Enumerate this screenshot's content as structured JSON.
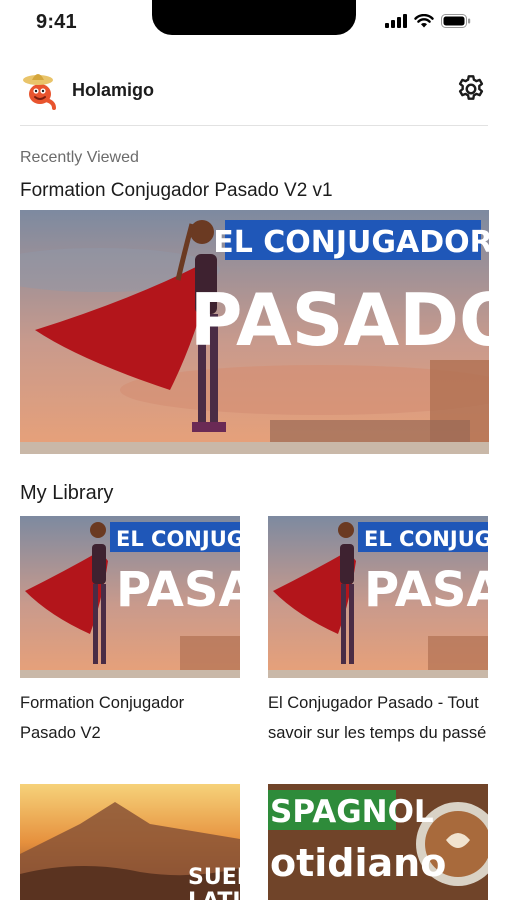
{
  "status_bar": {
    "time": "9:41"
  },
  "header": {
    "app_name": "Holamigo"
  },
  "recently_viewed": {
    "label": "Recently Viewed",
    "title": "Formation Conjugador Pasado V2 v1",
    "thumbnail": {
      "banner_line1": "EL CONJUGADOR",
      "banner_line2": "PASADO"
    }
  },
  "library": {
    "heading": "My Library",
    "items": [
      {
        "title": "Formation Conjugador Pasado V2",
        "banner_line1": "EL CONJUGAD",
        "banner_line2": "PASAD"
      },
      {
        "title": "El Conjugador Pasado - Tout savoir sur les temps du passé",
        "banner_line1": "EL CONJUGAD",
        "banner_line2": "PASAD"
      },
      {
        "banner_line1": "SUEN",
        "banner_line2": "LATIN"
      },
      {
        "banner_line1": "SPAGNOL",
        "banner_line2": "otidiano"
      }
    ]
  },
  "colors": {
    "banner_blue": "#1f57b8",
    "cape_red": "#b3151b",
    "sky_top": "#7d8aa0",
    "sky_bottom": "#e9a178",
    "accent_green": "#2e8b3a"
  }
}
